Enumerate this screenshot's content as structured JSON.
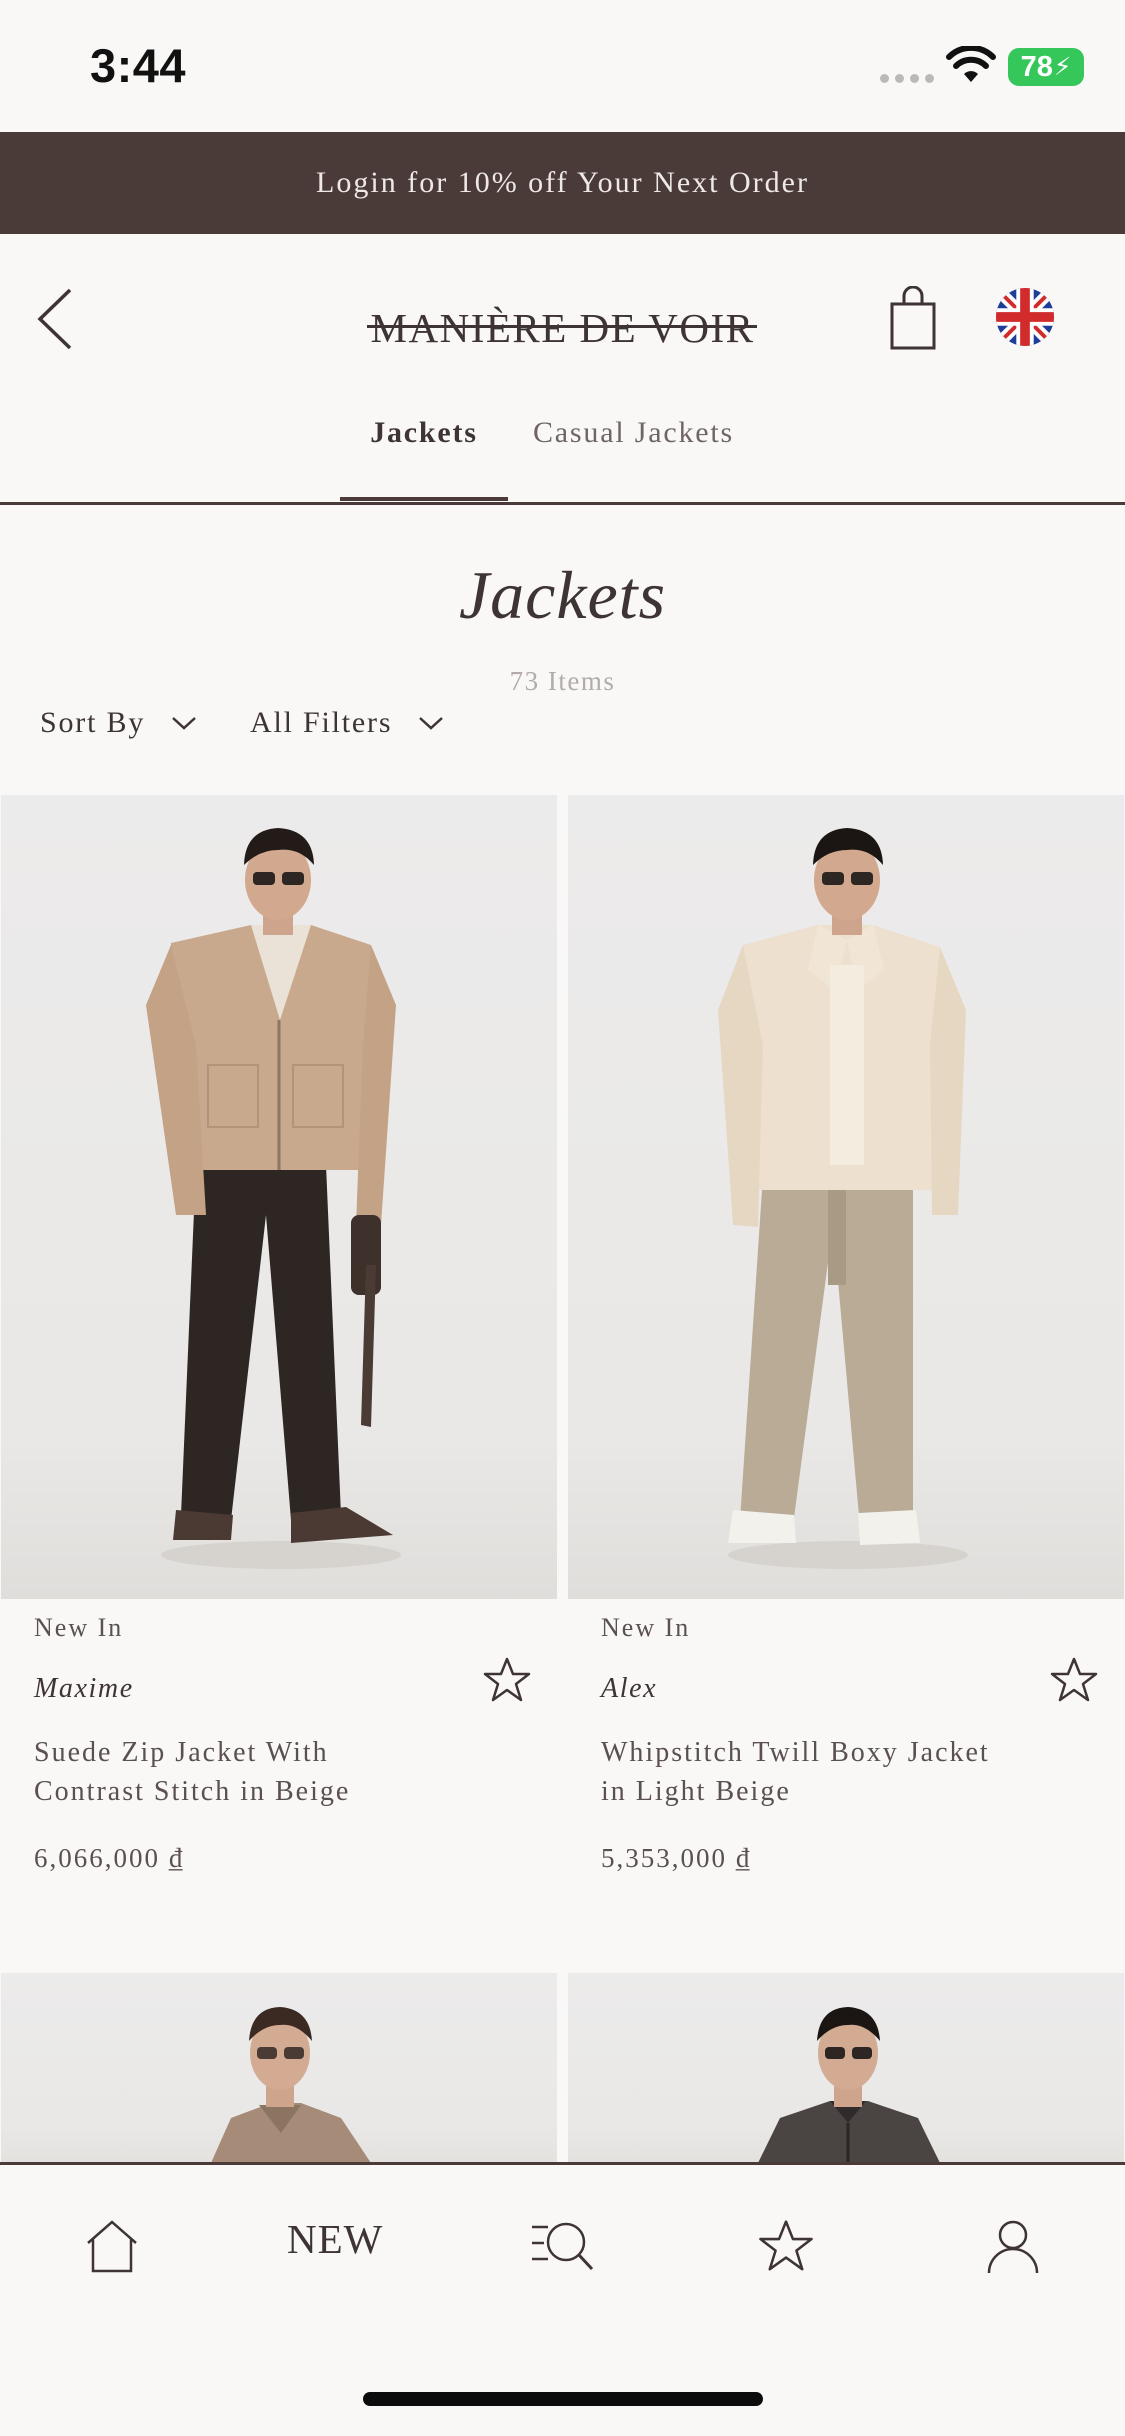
{
  "status_bar": {
    "time": "3:44",
    "battery": "78"
  },
  "promo_banner": {
    "text": "Login for 10% off Your Next Order"
  },
  "header": {
    "logo": "MANIÈRE DE VOIR"
  },
  "tabs": [
    {
      "label": "Jackets",
      "active": true
    },
    {
      "label": "Casual Jackets",
      "active": false
    }
  ],
  "listing": {
    "title": "Jackets",
    "count": "73 Items",
    "sort_label": "Sort By",
    "filter_label": "All Filters"
  },
  "products": [
    {
      "badge": "New In",
      "brand": "Maxime",
      "name": "Suede Zip Jacket With Contrast Stitch in Beige",
      "price": "6,066,000 ₫"
    },
    {
      "badge": "New In",
      "brand": "Alex",
      "name": "Whipstitch Twill Boxy Jacket in Light Beige",
      "price": "5,353,000 ₫"
    }
  ],
  "bottom_nav": {
    "new_label": "NEW"
  },
  "colors": {
    "brand_dark": "#4a3b39",
    "background": "#f9f8f6",
    "battery_green": "#35c759"
  }
}
